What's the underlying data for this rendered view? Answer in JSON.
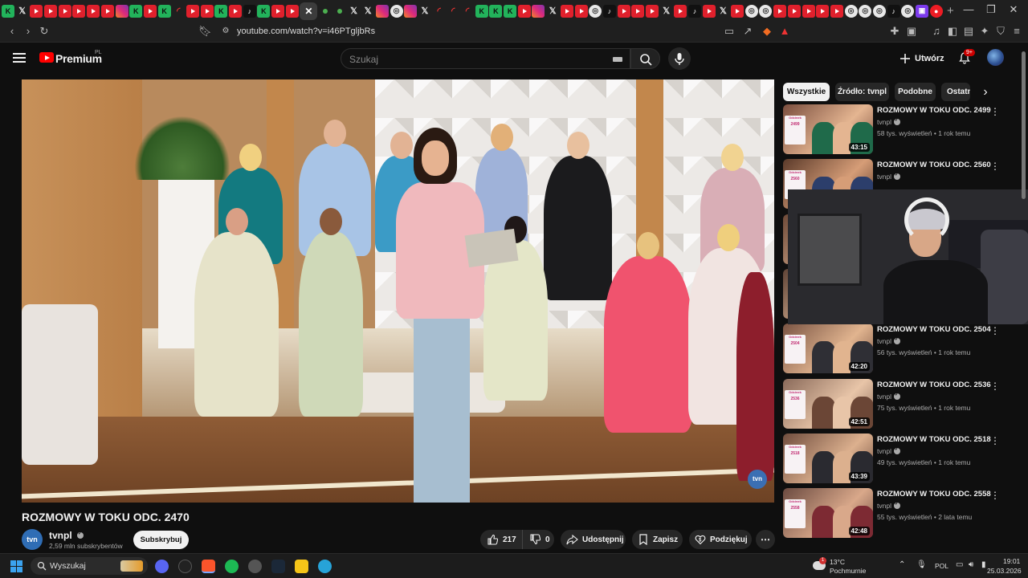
{
  "browser": {
    "url": "youtube.com/watch?v=i46PTgljbRs",
    "tabs": [
      "k",
      "x",
      "yt",
      "yt",
      "yt",
      "yt",
      "yt",
      "yt",
      "ig",
      "k",
      "yt",
      "k",
      "spin",
      "yt",
      "yt",
      "k",
      "yt",
      "tt",
      "k",
      "yt",
      "yt",
      "active",
      "dot",
      "dot",
      "x",
      "x",
      "ig",
      "g",
      "ig",
      "x",
      "spin",
      "spin",
      "spin",
      "k",
      "k",
      "k",
      "yt",
      "ig",
      "x",
      "yt",
      "yt",
      "g",
      "tt",
      "yt",
      "yt",
      "yt",
      "x",
      "yt",
      "tt",
      "yt",
      "x",
      "yt",
      "g",
      "g",
      "yt",
      "yt",
      "yt",
      "yt",
      "yt",
      "g",
      "g",
      "g",
      "tt",
      "g",
      "m",
      "c"
    ],
    "active_tab_close": "✕",
    "new_tab": "+"
  },
  "youtube": {
    "brand": "Premium",
    "region": "PL",
    "search_placeholder": "Szukaj",
    "create_label": "Utwórz",
    "notifications_badge": "9+"
  },
  "video": {
    "title": "ROZMOWY W TOKU ODC. 2470",
    "watermark": "tvn",
    "channel": {
      "avatar_text": "tvn",
      "name": "tvnpl",
      "subscribers": "2,59 mln subskrybentów",
      "subscribe_label": "Subskrybuj"
    },
    "actions": {
      "likes": "217",
      "dislikes": "0",
      "share": "Udostępnij",
      "save": "Zapisz",
      "thanks": "Podziękuj",
      "more": "⋯"
    }
  },
  "chips": [
    "Wszystkie",
    "Źródło: tvnpl",
    "Podobne",
    "Ostatn"
  ],
  "recommendations": [
    {
      "title": "ROZMOWY W TOKU ODC. 2499",
      "channel": "tvnpl",
      "meta": "58 tys. wyświetleń • 1 rok temu",
      "duration": "43:15",
      "card_num": "2499"
    },
    {
      "title": "ROZMOWY W TOKU ODC. 2560",
      "channel": "tvnpl",
      "meta": "",
      "duration": "",
      "card_num": "2560"
    },
    {
      "title": "",
      "channel": "",
      "meta": "",
      "duration": "",
      "card_num": ""
    },
    {
      "title": "",
      "channel": "",
      "meta": "",
      "duration": "",
      "card_num": ""
    },
    {
      "title": "ROZMOWY W TOKU ODC. 2504",
      "channel": "tvnpl",
      "meta": "56 tys. wyświetleń • 1 rok temu",
      "duration": "42:20",
      "card_num": "2504"
    },
    {
      "title": "ROZMOWY W TOKU ODC. 2536",
      "channel": "tvnpl",
      "meta": "75 tys. wyświetleń • 1 rok temu",
      "duration": "42:51",
      "card_num": "2536"
    },
    {
      "title": "ROZMOWY W TOKU ODC. 2518",
      "channel": "tvnpl",
      "meta": "49 tys. wyświetleń • 1 rok temu",
      "duration": "43:39",
      "card_num": "2518"
    },
    {
      "title": "ROZMOWY W TOKU ODC. 2558",
      "channel": "tvnpl",
      "meta": "55 tys. wyświetleń • 2 lata temu",
      "duration": "42:48",
      "card_num": "2558"
    }
  ],
  "thumb_card_label": "Odcinek",
  "taskbar": {
    "search_placeholder": "Wyszukaj",
    "weather_temp": "13°C",
    "weather_desc": "Pochmurnie",
    "weather_badge": "1",
    "language": "POL",
    "time": "19:01",
    "date": "25.03.2026"
  },
  "colors": {
    "background": "#0f0f0f",
    "youtube_red": "#ff0000",
    "chip_bg": "#272727",
    "text_secondary": "#aaaaaa"
  }
}
